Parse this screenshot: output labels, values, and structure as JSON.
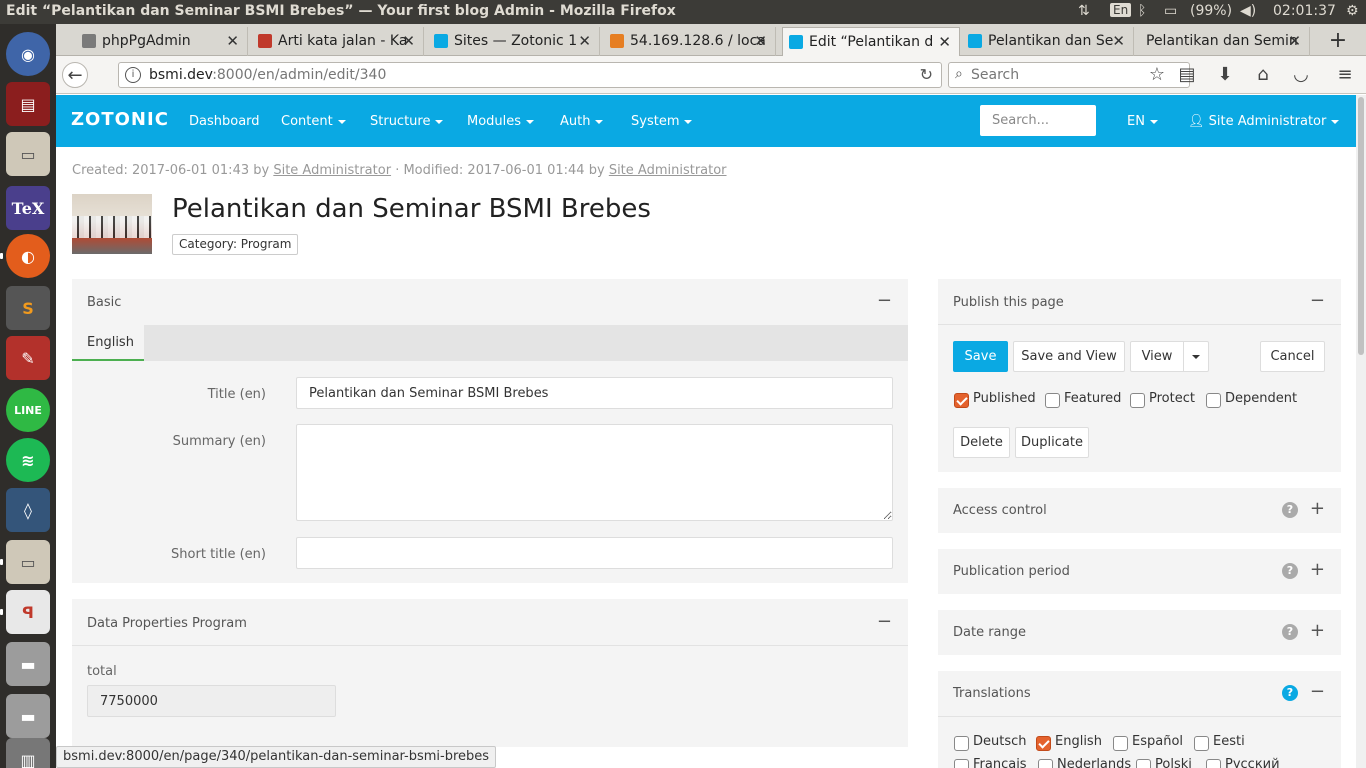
{
  "os": {
    "window_title": "Edit “Pelantikan dan Seminar BSMI Brebes” — Your first blog Admin - Mozilla Firefox",
    "keyboard": "En",
    "battery": "(99%)",
    "time": "02:01:37"
  },
  "browser": {
    "tabs": [
      {
        "label": "phpPgAdmin",
        "icon_color": "#7a7a7a"
      },
      {
        "label": "Arti kata jalan - Ka",
        "icon_color": "#c0392b"
      },
      {
        "label": "Sites — Zotonic 1",
        "icon_color": "#0aa9e3"
      },
      {
        "label": "54.169.128.6 / loca",
        "icon_color": "#e67e22"
      },
      {
        "label": "Edit “Pelantikan d",
        "icon_color": "#0aa9e3"
      },
      {
        "label": "Pelantikan dan Se",
        "icon_color": "#0aa9e3"
      },
      {
        "label": "Pelantikan dan Semin",
        "icon_color": ""
      }
    ],
    "url_host": "bsmi.dev",
    "url_rest": ":8000/en/admin/edit/340",
    "search_placeholder": "Search"
  },
  "admin_nav": {
    "logo": "ZOTONIC",
    "menu": [
      "Dashboard",
      "Content",
      "Structure",
      "Modules",
      "Auth",
      "System"
    ],
    "search_placeholder": "Search...",
    "language": "EN",
    "user": "Site Administrator"
  },
  "page": {
    "meta_created_prefix": "Created: 2017-06-01 01:43 by",
    "meta_created_by": "Site Administrator",
    "meta_modified_prefix": "· Modified: 2017-06-01 01:44 by",
    "meta_modified_by": "Site Administrator",
    "title": "Pelantikan dan Seminar BSMI Brebes",
    "category": "Category: Program"
  },
  "basic_panel": {
    "title": "Basic",
    "toggle": "−",
    "lang_tab": "English",
    "title_label": "Title (en)",
    "title_value": "Pelantikan dan Seminar BSMI Brebes",
    "summary_label": "Summary (en)",
    "summary_value": "",
    "short_title_label": "Short title (en)",
    "short_title_value": ""
  },
  "data_panel": {
    "title": "Data Properties Program",
    "toggle": "−",
    "total_label": "total",
    "total_value": "7750000"
  },
  "publish_panel": {
    "title": "Publish this page",
    "toggle": "−",
    "save": "Save",
    "save_and_view": "Save and View",
    "view": "View",
    "cancel": "Cancel",
    "delete": "Delete",
    "duplicate": "Duplicate",
    "flags": [
      {
        "label": "Published",
        "checked": true
      },
      {
        "label": "Featured",
        "checked": false
      },
      {
        "label": "Protect",
        "checked": false
      },
      {
        "label": "Dependent",
        "checked": false
      }
    ]
  },
  "side_panels": [
    {
      "title": "Access control",
      "toggle": "+"
    },
    {
      "title": "Publication period",
      "toggle": "+"
    },
    {
      "title": "Date range",
      "toggle": "+"
    }
  ],
  "translations_panel": {
    "title": "Translations",
    "toggle": "−",
    "languages": [
      {
        "label": "Deutsch",
        "checked": false
      },
      {
        "label": "English",
        "checked": true
      },
      {
        "label": "Español",
        "checked": false
      },
      {
        "label": "Eesti",
        "checked": false
      },
      {
        "label": "Français",
        "checked": false
      },
      {
        "label": "Nederlands",
        "checked": false
      },
      {
        "label": "Polski",
        "checked": false
      },
      {
        "label": "Русский",
        "checked": false
      }
    ]
  },
  "status_bar": {
    "link": "bsmi.dev:8000/en/page/340/pelantikan-dan-seminar-bsmi-brebes"
  },
  "colors": {
    "accent": "#0aa9e3",
    "checkbox_on": "#e4622d",
    "tab_underline": "#4caf50"
  }
}
